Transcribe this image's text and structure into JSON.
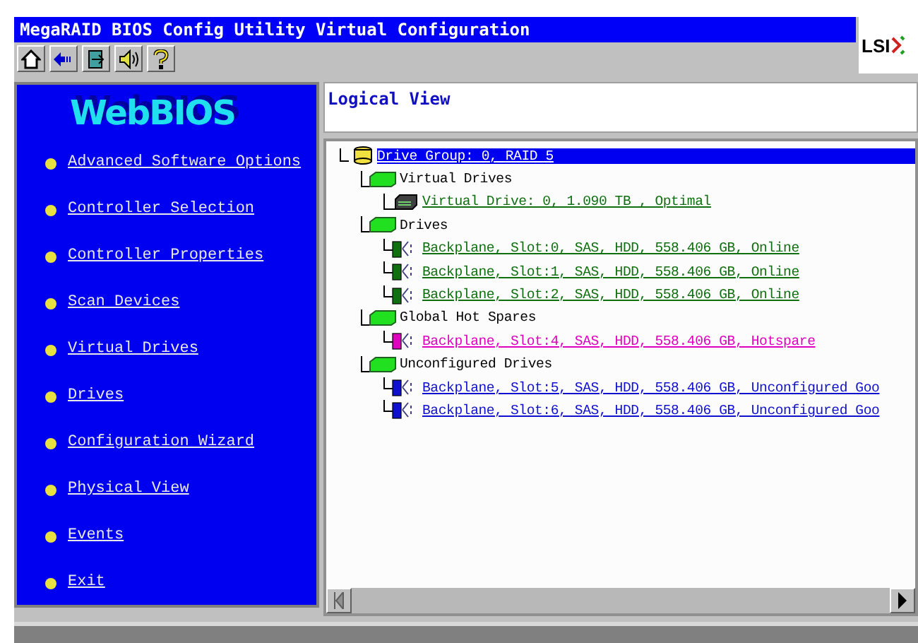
{
  "window": {
    "title": "MegaRAID BIOS Config Utility Virtual Configuration",
    "brand": "LSI"
  },
  "toolbar": [
    {
      "kind": "home"
    },
    {
      "kind": "back"
    },
    {
      "kind": "exit"
    },
    {
      "kind": "sound"
    },
    {
      "kind": "help"
    }
  ],
  "sidebar": {
    "logo": "WebBIOS",
    "items": [
      {
        "label": "Advanced Software Options"
      },
      {
        "label": "Controller Selection"
      },
      {
        "label": "Controller Properties"
      },
      {
        "label": "Scan Devices"
      },
      {
        "label": "Virtual Drives"
      },
      {
        "label": "Drives"
      },
      {
        "label": "Configuration Wizard"
      },
      {
        "label": "Physical View"
      },
      {
        "label": "Events"
      },
      {
        "label": "Exit"
      }
    ]
  },
  "logical_view": {
    "title": "Logical View",
    "tree": [
      {
        "kind": "group",
        "label": "Drive Group: 0, RAID 5",
        "selected": true,
        "children": [
          {
            "kind": "folder",
            "label": "Virtual Drives",
            "selected": false,
            "children": [
              {
                "kind": "virtual_drive",
                "label": "Virtual Drive: 0, 1.090 TB , Optimal",
                "selected": false,
                "color": "#107010"
              }
            ]
          },
          {
            "kind": "folder",
            "label": "Drives",
            "selected": false,
            "children": [
              {
                "kind": "drive",
                "label": "Backplane, Slot:0, SAS, HDD, 558.406 GB, Online",
                "selected": false,
                "color": "#107010"
              },
              {
                "kind": "drive",
                "label": "Backplane, Slot:1, SAS, HDD, 558.406 GB, Online",
                "selected": false,
                "color": "#107010"
              },
              {
                "kind": "drive",
                "label": "Backplane, Slot:2, SAS, HDD, 558.406 GB, Online",
                "selected": false,
                "color": "#107010"
              }
            ]
          },
          {
            "kind": "folder",
            "label": "Global Hot Spares",
            "selected": false,
            "children": [
              {
                "kind": "drive",
                "label": "Backplane, Slot:4, SAS, HDD, 558.406 GB, Hotspare",
                "selected": false,
                "color": "#e000c0"
              }
            ]
          },
          {
            "kind": "folder",
            "label": "Unconfigured Drives",
            "selected": false,
            "children": [
              {
                "kind": "drive",
                "label": "Backplane, Slot:5, SAS, HDD, 558.406 GB, Unconfigured Goo",
                "selected": false,
                "color": "#1010d0"
              },
              {
                "kind": "drive",
                "label": "Backplane, Slot:6, SAS, HDD, 558.406 GB, Unconfigured Goo",
                "selected": false,
                "color": "#1010d0"
              }
            ]
          }
        ]
      }
    ]
  }
}
